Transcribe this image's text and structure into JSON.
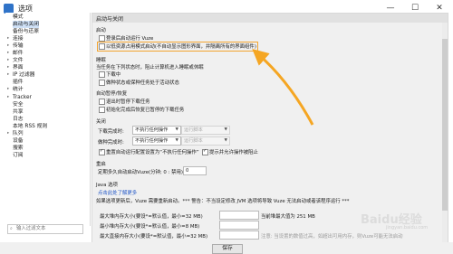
{
  "window": {
    "title": "选项",
    "min": "—",
    "max": "☐",
    "close": "✕"
  },
  "sidebar": {
    "items": [
      {
        "label": "模式",
        "exp": "",
        "selected": false
      },
      {
        "label": "启动与关闭",
        "exp": "",
        "selected": true
      },
      {
        "label": "备份与还原",
        "exp": "",
        "selected": false
      },
      {
        "label": "连接",
        "exp": "▸",
        "selected": false
      },
      {
        "label": "传输",
        "exp": "▸",
        "selected": false
      },
      {
        "label": "邮件",
        "exp": "▸",
        "selected": false
      },
      {
        "label": "文件",
        "exp": "▸",
        "selected": false
      },
      {
        "label": "界面",
        "exp": "▸",
        "selected": false
      },
      {
        "label": "IP 过滤器",
        "exp": "▸",
        "selected": false
      },
      {
        "label": "插件",
        "exp": "",
        "selected": false
      },
      {
        "label": "统计",
        "exp": "▸",
        "selected": false
      },
      {
        "label": "Tracker",
        "exp": "▸",
        "selected": false
      },
      {
        "label": "安全",
        "exp": "",
        "selected": false
      },
      {
        "label": "共享",
        "exp": "",
        "selected": false
      },
      {
        "label": "日志",
        "exp": "",
        "selected": false
      },
      {
        "label": "本地 RSS 规则",
        "exp": "",
        "selected": false
      },
      {
        "label": "队列",
        "exp": "▸",
        "selected": false
      },
      {
        "label": "设备",
        "exp": "",
        "selected": false
      },
      {
        "label": "搜索",
        "exp": "",
        "selected": false
      },
      {
        "label": "订阅",
        "exp": "",
        "selected": false
      }
    ],
    "search_placeholder": "输入过滤文本"
  },
  "page": {
    "header": "启动与关闭",
    "startup": {
      "heading": "启动",
      "opt1": "登录后启动运行 Vuze",
      "opt2": "以低资源占用模式启动(不自动显示图形界面，并隔离所有的界面组件)"
    },
    "sleep": {
      "heading": "睡眠",
      "desc": "当任务在下列状态时，阻止计算机进入睡眠或休眠",
      "opt1": "下载中",
      "opt2": "做种状态或保种任务处于活动状态"
    },
    "pause": {
      "heading": "自动暂停/恢复",
      "opt1": "退出时暂停下载任务",
      "opt2": "初始化完成后恢复已暂停的下载任务"
    },
    "close": {
      "heading": "关闭",
      "label1": "下载完成时:",
      "label2": "做种完成时:",
      "dropdown_value": "不执行任何操作",
      "script_label": "运行脚本",
      "opt1": "重置自动运行配置设置为“不执行任何操作”",
      "opt2": "提示并允许操作被阻止"
    },
    "restart": {
      "heading": "重启",
      "label": "定期多久自动启动Vuze(分钟; 0 : 禁用)",
      "value": "0"
    },
    "java": {
      "heading": "Java 选项",
      "link": "点击此处了解更多",
      "desc": "如果选项更新后，Vuze 需要重新启动。*** 警告：不当设定修改 JVM 选项将导致 Vuze 无法启动或者该程序运行 ***",
      "row1_label": "最大堆内存大小(要设*=默认值，最小=32 MB)",
      "row1_info": "当前堆最大值为 251 MB",
      "row2_label": "最小堆内存大小(要设*=默认值，最小=8 MB)",
      "row3_label": "最大直接内存大小(要设*=默认值，最小=32 MB)",
      "row3_info": "注意: 当设置的数值过高，如超出可用内存，则Vuze可能无法启动"
    }
  },
  "footer": {
    "save_label": "保存"
  },
  "watermark": {
    "text": "Baidu经验",
    "sub": "jingyan.baidu.com"
  }
}
